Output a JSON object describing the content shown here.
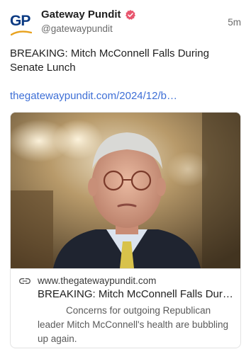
{
  "post": {
    "author": {
      "display_name": "Gateway Pundit",
      "handle": "@gatewaypundit",
      "avatar_text": "GP",
      "verified": true
    },
    "time": "5m",
    "text": "BREAKING: Mitch McConnell Falls During Senate Lunch",
    "link_text": "thegatewaypundit.com/2024/12/b…"
  },
  "link_card": {
    "domain": "www.thegatewaypundit.com",
    "title": "BREAKING: Mitch McConnell Falls Dur…",
    "description": "Concerns for outgoing Republican leader Mitch McConnell's health are bubbling up again."
  },
  "colors": {
    "link": "#3e6fd6",
    "verified": "#e8566e",
    "brand": "#0b3a82"
  },
  "icons": {
    "verified": "verified-badge-icon",
    "link": "link-icon"
  }
}
